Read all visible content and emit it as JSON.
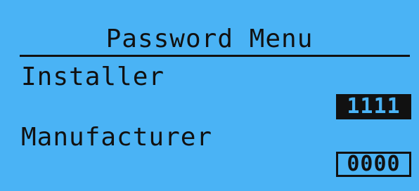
{
  "menu": {
    "title": "Password Menu"
  },
  "fields": {
    "installer": {
      "label": "Installer",
      "value": "1111",
      "selected": true
    },
    "manufacturer": {
      "label": "Manufacturer",
      "value": "0000",
      "selected": false
    }
  },
  "colors": {
    "background": "#4ab3f5",
    "foreground": "#111111"
  }
}
